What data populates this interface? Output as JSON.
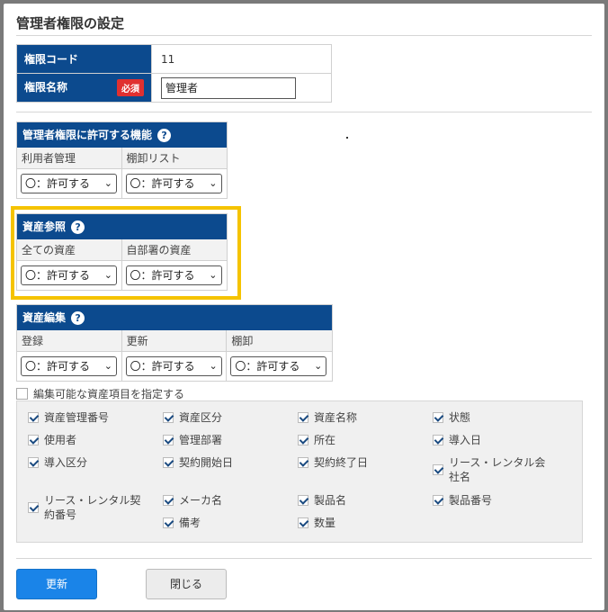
{
  "dialog": {
    "title": "管理者権限の設定",
    "code_label": "権限コード",
    "code_value": "11",
    "name_label": "権限名称",
    "required_badge": "必須",
    "name_value": "管理者"
  },
  "section_functions": {
    "title": "管理者権限に許可する機能",
    "columns": [
      {
        "label": "利用者管理",
        "value": "〇：許可する"
      },
      {
        "label": "棚卸リスト",
        "value": "〇：許可する"
      }
    ]
  },
  "section_asset_ref": {
    "title": "資産参照",
    "columns": [
      {
        "label": "全ての資産",
        "value": "〇：許可する"
      },
      {
        "label": "自部署の資産",
        "value": "〇：許可する"
      }
    ]
  },
  "section_asset_edit": {
    "title": "資産編集",
    "columns": [
      {
        "label": "登録",
        "value": "〇：許可する"
      },
      {
        "label": "更新",
        "value": "〇：許可する"
      },
      {
        "label": "棚卸",
        "value": "〇：許可する"
      }
    ]
  },
  "editable_toggle_label": "編集可能な資産項目を指定する",
  "items": [
    "資産管理番号",
    "資産区分",
    "資産名称",
    "状態",
    "使用者",
    "管理部署",
    "所在",
    "導入日",
    "導入区分",
    "契約開始日",
    "契約終了日",
    "リース・レンタル会社名",
    "リース・レンタル契約番号",
    "メーカ名",
    "製品名",
    "製品番号",
    "備考",
    "数量"
  ],
  "buttons": {
    "update": "更新",
    "close": "閉じる"
  },
  "colors": {
    "header_blue": "#0c4a8e",
    "highlight": "#f5c300",
    "primary": "#1a84e8",
    "required": "#e03030"
  }
}
